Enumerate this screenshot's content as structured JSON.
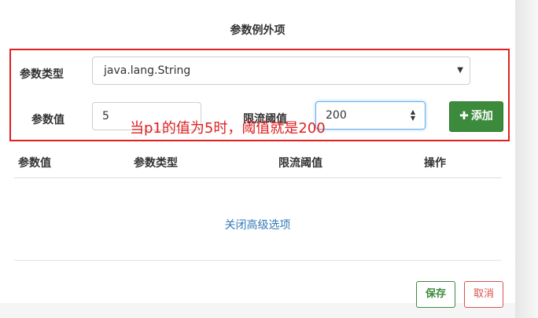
{
  "section_title": "参数例外项",
  "form": {
    "param_type_label": "参数类型",
    "param_type_value": "java.lang.String",
    "param_value_label": "参数值",
    "param_value": "5",
    "threshold_label": "限流阈值",
    "threshold_value": "200",
    "add_label": "添加"
  },
  "annotation": "当p1的值为5时，阈值就是200",
  "table": {
    "headers": [
      "参数值",
      "参数类型",
      "限流阈值",
      "操作"
    ]
  },
  "advanced_link": "关闭高级选项",
  "footer": {
    "save_label": "保存",
    "cancel_label": "取消"
  },
  "colors": {
    "highlight_border": "#e02020",
    "add_button": "#3c8a3c",
    "link": "#337ab7",
    "cancel": "#d9534f"
  }
}
